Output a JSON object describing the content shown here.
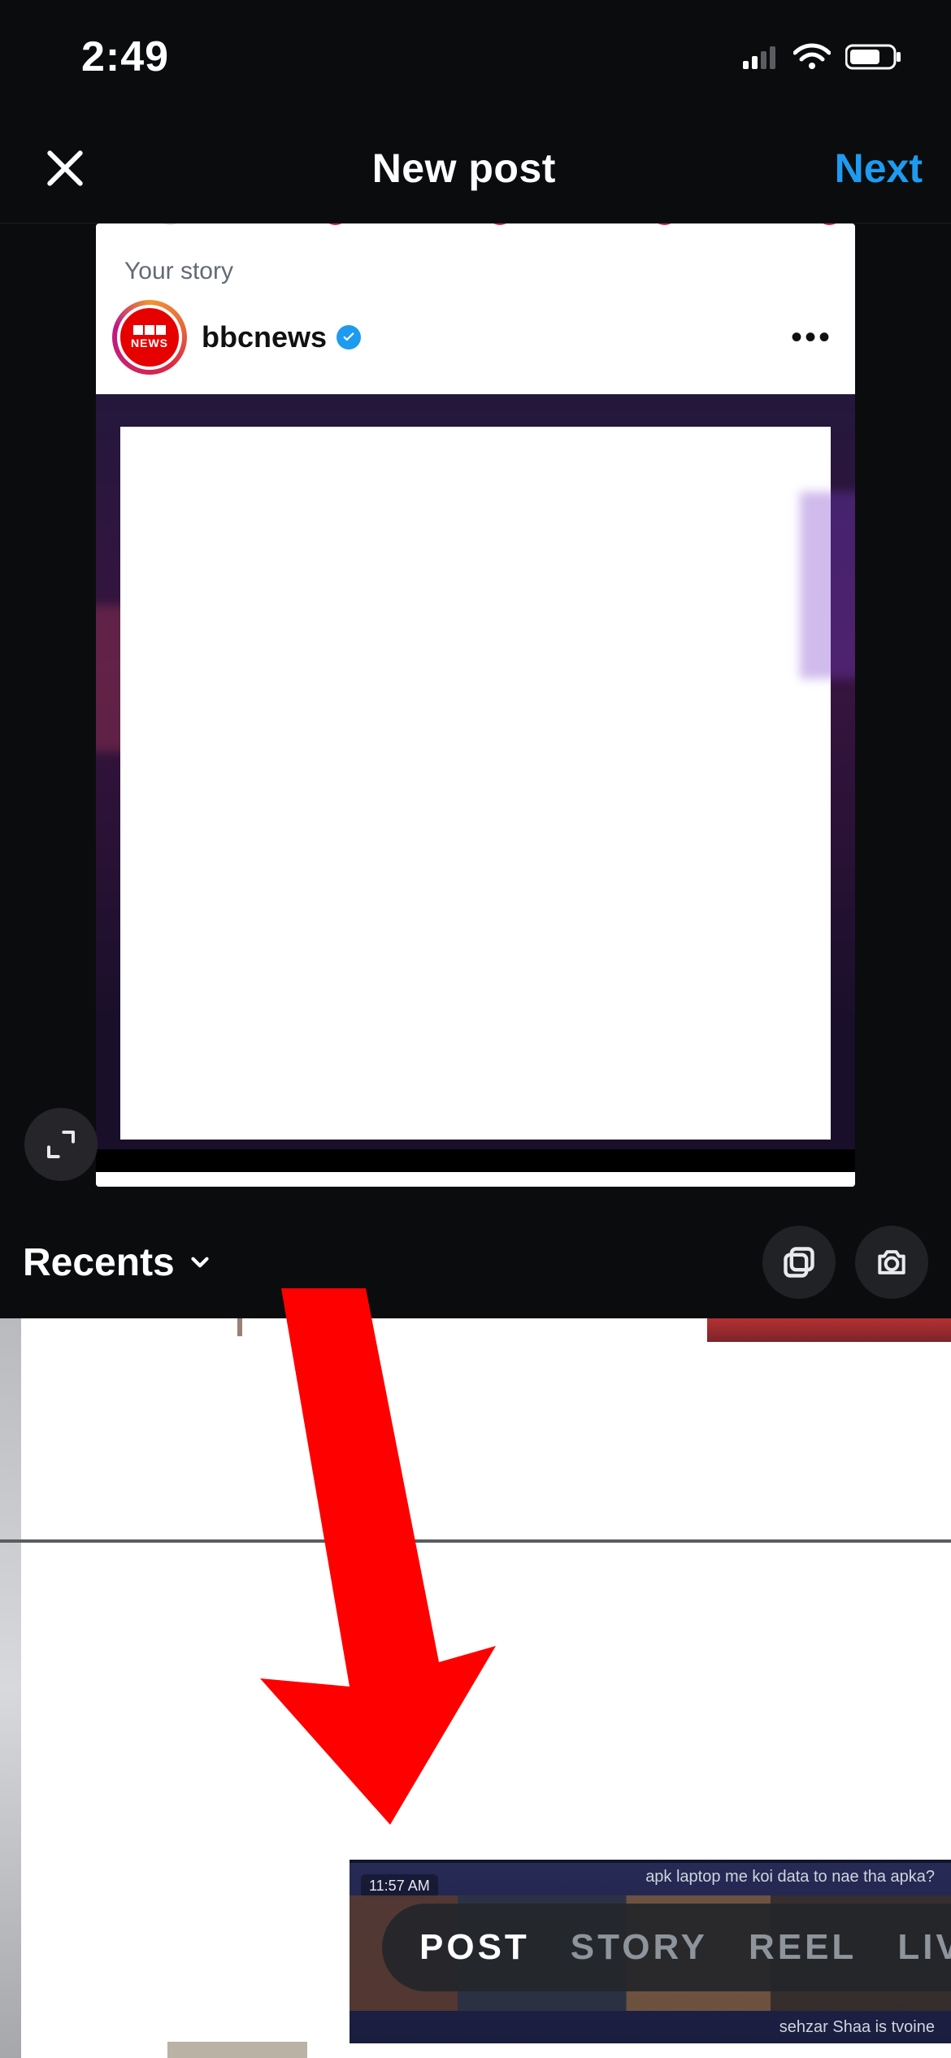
{
  "status": {
    "time": "2:49"
  },
  "header": {
    "title": "New post",
    "next_label": "Next"
  },
  "preview": {
    "story_label": "Your story",
    "post_user": "bbcnews",
    "avatar_text": "NEWS"
  },
  "album": {
    "label": "Recents"
  },
  "modes": {
    "items": [
      {
        "label": "POST",
        "active": true
      },
      {
        "label": "STORY",
        "active": false
      },
      {
        "label": "REEL",
        "active": false
      },
      {
        "label": "LIVE",
        "active": false
      }
    ]
  },
  "thumb": {
    "time_badge": "11:57 AM",
    "caption_top": "apk laptop me koi data to nae tha apka?",
    "caption_bottom": "sehzar Shaa is tvoine"
  }
}
